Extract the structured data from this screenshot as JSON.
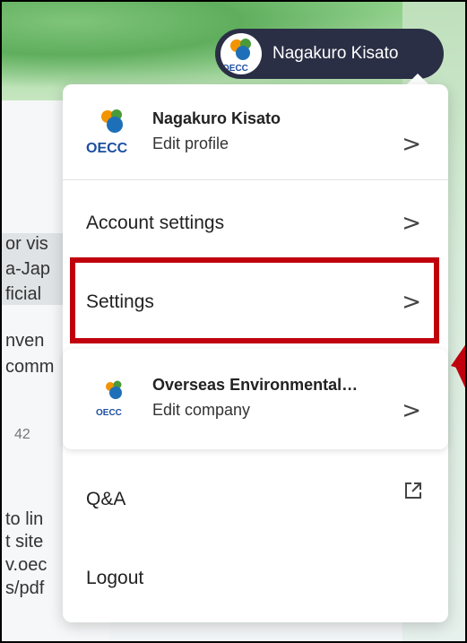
{
  "user": {
    "name": "Nagakuro Kisato",
    "avatar_text": "OECC"
  },
  "menu": {
    "profile": {
      "name": "Nagakuro Kisato",
      "sub": "Edit profile",
      "logo_text": "OECC"
    },
    "account_settings": "Account settings",
    "settings": "Settings",
    "company": {
      "name": "Overseas Environmental…",
      "sub": "Edit company",
      "logo_text": "OECC"
    },
    "qa": "Q&A",
    "logout": "Logout",
    "chevron": ">"
  },
  "background": {
    "lines": [
      "or vis",
      "a-Jap",
      "ficial",
      "nven",
      "comm",
      "to lin",
      "t site",
      "v.oec",
      "s/pdf"
    ],
    "number": "42"
  },
  "colors": {
    "highlight": "#c0000c",
    "pill": "#2a2f45"
  },
  "icons": {
    "external": "external-link-icon",
    "chevron": "chevron-right-icon"
  }
}
